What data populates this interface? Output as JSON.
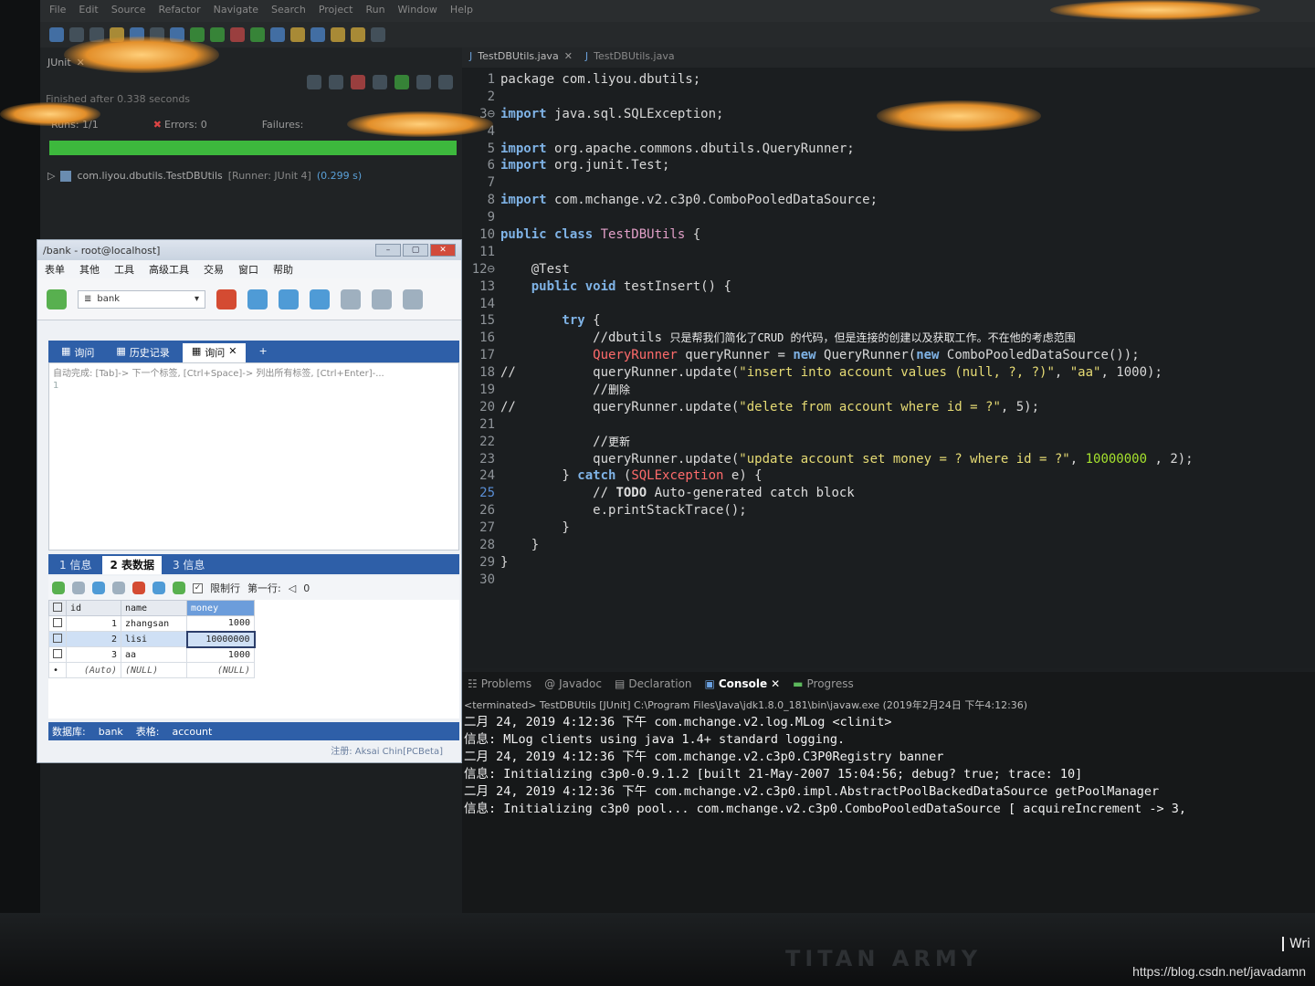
{
  "menubar": [
    "File",
    "Edit",
    "Source",
    "Refactor",
    "Navigate",
    "Search",
    "Project",
    "Run",
    "Window",
    "Help"
  ],
  "junit": {
    "tab_label": "JUnit",
    "finished": "Finished after 0.338 seconds",
    "runs": "Runs:  1/1",
    "errors": "Errors:  0",
    "failures": "Failures:",
    "tree_item": "com.liyou.dbutils.TestDBUtils",
    "tree_runner": "[Runner: JUnit 4]",
    "tree_time": "(0.299 s)",
    "progress": 1.0,
    "bar_color": "#3db83d"
  },
  "editor": {
    "tabs": [
      {
        "label": "TestDBUtils.java",
        "active": true
      },
      {
        "label": "TestDBUtils.java",
        "active": false
      }
    ]
  },
  "code": {
    "l1": "package com.liyou.dbutils;",
    "l3a": "import",
    "l3b": " java.sql.SQLException;",
    "l5a": "import",
    "l5b": " org.apache.commons.dbutils.QueryRunner;",
    "l6a": "import",
    "l6b": " org.junit.Test;",
    "l8a": "import",
    "l8b": " com.mchange.v2.c3p0.ComboPooledDataSource;",
    "l10a": "public class ",
    "l10b": "TestDBUtils",
    "l10c": " {",
    "l12": "    @Test",
    "l13a": "    public void",
    "l13b": " testInsert() {",
    "l15a": "        try",
    "l15b": " {",
    "l16a": "            //dbutils ",
    "l16b": "只是帮我们简化了CRUD 的代码，但是连接的创建以及获取工作。不在他的考虑范围",
    "l17a": "            QueryRunner",
    "l17b": " queryRunner = ",
    "l17c": "new",
    "l17d": " QueryRunner(",
    "l17e": "new",
    "l17f": " ComboPooledDataSource());",
    "l18a": "//          queryRunner.update(",
    "l18b": "\"insert into account values (null, ?, ?)\"",
    "l18c": ", ",
    "l18d": "\"aa\"",
    "l18e": ", 1000);",
    "l19a": "            //",
    "l19b": "删除",
    "l20a": "//          queryRunner.update(",
    "l20b": "\"delete from account where id = ?\"",
    "l20c": ", 5);",
    "l22a": "            //",
    "l22b": "更新",
    "l23a": "            queryRunner.update(",
    "l23b": "\"update account set money = ? where id = ?\"",
    "l23c": ", ",
    "l23d": "10000000",
    "l23e": " , 2);",
    "l24a": "        } ",
    "l24b": "catch",
    "l24c": " (",
    "l24d": "SQLException",
    "l24e": " e) {",
    "l25a": "            // ",
    "l25b": "TODO",
    "l25c": " Auto-generated catch block",
    "l26": "            e.printStackTrace();",
    "l27": "        }",
    "l28": "    }",
    "l29": "}"
  },
  "console": {
    "tabs": [
      "Problems",
      "Javadoc",
      "Declaration",
      "Console",
      "Progress"
    ],
    "terminated": "<terminated> TestDBUtils [JUnit] C:\\Program Files\\Java\\jdk1.8.0_181\\bin\\javaw.exe (2019年2月24日 下午4:12:36)",
    "lines": [
      "二月 24, 2019 4:12:36 下午 com.mchange.v2.log.MLog <clinit>",
      "信息: MLog clients using java 1.4+ standard logging.",
      "二月 24, 2019 4:12:36 下午 com.mchange.v2.c3p0.C3P0Registry banner",
      "信息: Initializing c3p0-0.9.1.2 [built 21-May-2007 15:04:56; debug? true; trace: 10]",
      "二月 24, 2019 4:12:36 下午 com.mchange.v2.c3p0.impl.AbstractPoolBackedDataSource getPoolManager",
      "信息: Initializing c3p0 pool... com.mchange.v2.c3p0.ComboPooledDataSource [ acquireIncrement -> 3,"
    ]
  },
  "sqlyog": {
    "title": "/bank - root@localhost]",
    "menu": [
      "表单",
      "其他",
      "工具",
      "高级工具",
      "交易",
      "窗口",
      "帮助"
    ],
    "db_select": "bank",
    "query_tabs": [
      "询问",
      "历史记录",
      "询问"
    ],
    "hint": "自动完成: [Tab]-> 下一个标签, [Ctrl+Space]-> 列出所有标签, [Ctrl+Enter]-...",
    "line_no": "1",
    "result_tabs": [
      "1 信息",
      "2 表数据",
      "3 信息"
    ],
    "limit_label": "限制行",
    "first_row_label": "第一行:",
    "first_row_value": "0",
    "columns": [
      "id",
      "name",
      "money"
    ],
    "rows": [
      {
        "id": "1",
        "name": "zhangsan",
        "money": "1000"
      },
      {
        "id": "2",
        "name": "lisi",
        "money": "10000000"
      },
      {
        "id": "3",
        "name": "aa",
        "money": "1000"
      },
      {
        "id": "(Auto)",
        "name": "(NULL)",
        "money": "(NULL)"
      }
    ],
    "status_db_label": "数据库:",
    "status_db": "bank",
    "status_table_label": "表格:",
    "status_table": "account",
    "note": "注册: Aksai Chin[PCBeta]"
  },
  "monitor": {
    "brand": "TITAN ARMY",
    "win_hint": "Wri"
  },
  "watermark": "https://blog.csdn.net/javadamn"
}
